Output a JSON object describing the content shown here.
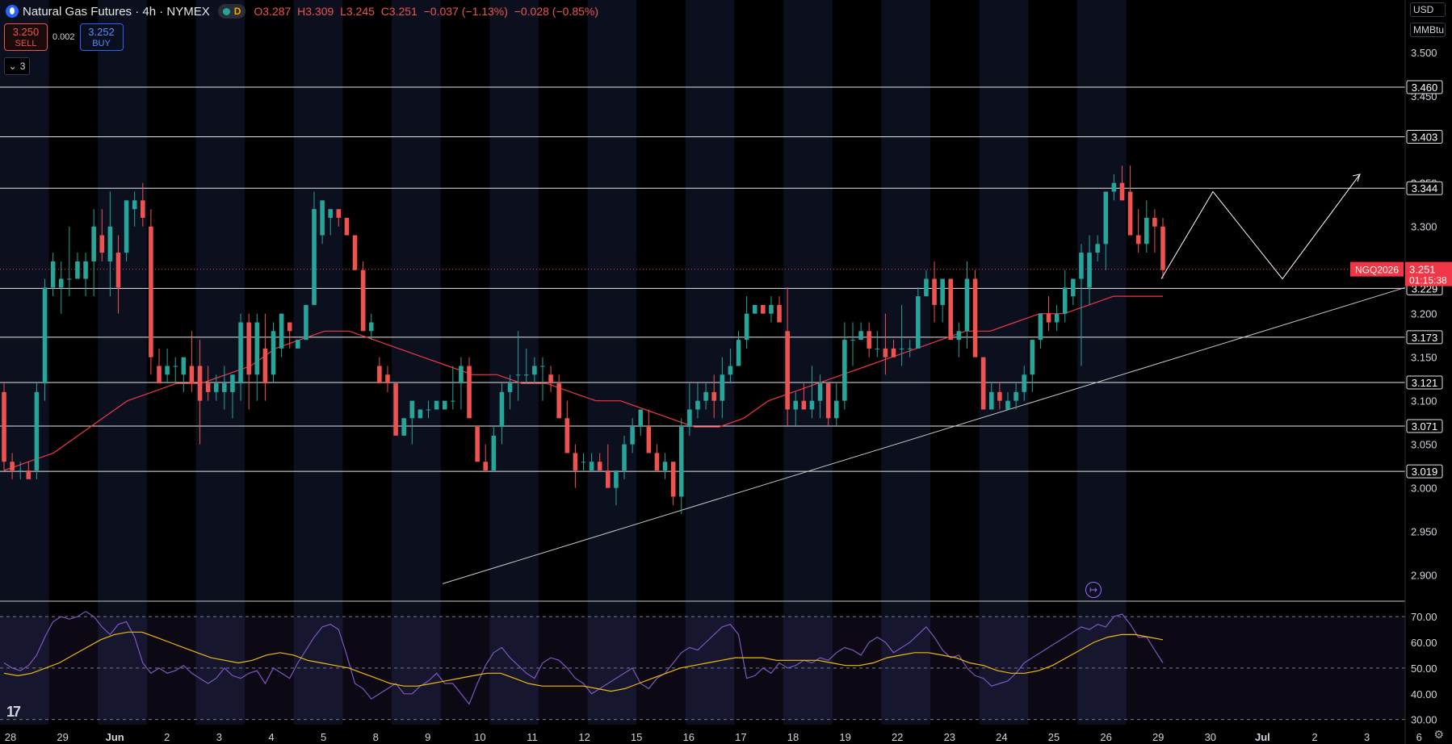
{
  "header": {
    "title": "Natural Gas Futures · 4h · NYMEX",
    "d_label": "D",
    "open": "O3.287",
    "high": "H3.309",
    "low": "L3.245",
    "close": "C3.251",
    "change": "−0.037 (−1.13%)",
    "change2": "−0.028 (−0.85%)",
    "dot_colors": [
      "#26a69a",
      "#2a2e39"
    ],
    "accent_color": "#2962ff"
  },
  "trade": {
    "sell_price": "3.250",
    "sell_label": "SELL",
    "spread": "0.002",
    "buy_price": "3.252",
    "buy_label": "BUY"
  },
  "indicators_collapse": {
    "count": "3"
  },
  "unit_selector": {
    "currency": "USD",
    "unit": "MMBtu"
  },
  "footer": {
    "logo": "17"
  },
  "chart_data": [
    {
      "type": "candlestick",
      "title": "Natural Gas Futures · 4h · NYMEX",
      "symbol": "NGQ2026",
      "ylim": [
        2.87,
        3.56
      ],
      "y_ticks": [
        "3.500",
        "3.450",
        "3.350",
        "3.300",
        "3.200",
        "3.150",
        "3.100",
        "3.050",
        "3.000",
        "2.950",
        "2.900"
      ],
      "x_tick_labels": [
        "28",
        "29",
        "Jun",
        "2",
        "3",
        "4",
        "5",
        "8",
        "9",
        "10",
        "11",
        "12",
        "15",
        "16",
        "17",
        "18",
        "19",
        "22",
        "23",
        "24",
        "25",
        "26",
        "29",
        "30",
        "Jul",
        "2",
        "3",
        "6"
      ],
      "horizontal_levels": [
        "3.460",
        "3.403",
        "3.344",
        "3.229",
        "3.173",
        "3.121",
        "3.071",
        "3.019"
      ],
      "last_price": {
        "value": "3.251",
        "countdown": "01:15:38",
        "label": "NGQ2026",
        "color": "#f23645"
      },
      "up_color": "#26a69a",
      "down_color": "#ef5350",
      "candles": [
        [
          3.11,
          3.12,
          3.02,
          3.03
        ],
        [
          3.03,
          3.04,
          3.01,
          3.02
        ],
        [
          3.02,
          3.03,
          3.01,
          3.02
        ],
        [
          3.02,
          3.03,
          3.01,
          3.01
        ],
        [
          3.02,
          3.12,
          3.01,
          3.11
        ],
        [
          3.12,
          3.24,
          3.1,
          3.23
        ],
        [
          3.23,
          3.27,
          3.22,
          3.26
        ],
        [
          3.23,
          3.26,
          3.2,
          3.24
        ],
        [
          3.24,
          3.3,
          3.22,
          3.24
        ],
        [
          3.24,
          3.27,
          3.24,
          3.26
        ],
        [
          3.24,
          3.27,
          3.22,
          3.26
        ],
        [
          3.26,
          3.32,
          3.22,
          3.3
        ],
        [
          3.29,
          3.32,
          3.26,
          3.27
        ],
        [
          3.26,
          3.34,
          3.22,
          3.3
        ],
        [
          3.27,
          3.29,
          3.2,
          3.23
        ],
        [
          3.27,
          3.33,
          3.26,
          3.33
        ],
        [
          3.32,
          3.34,
          3.3,
          3.33
        ],
        [
          3.33,
          3.35,
          3.3,
          3.31
        ],
        [
          3.3,
          3.32,
          3.13,
          3.15
        ],
        [
          3.14,
          3.16,
          3.12,
          3.12
        ],
        [
          3.13,
          3.16,
          3.12,
          3.14
        ],
        [
          3.14,
          3.15,
          3.12,
          3.14
        ],
        [
          3.13,
          3.15,
          3.11,
          3.15
        ],
        [
          3.14,
          3.18,
          3.11,
          3.12
        ],
        [
          3.14,
          3.17,
          3.05,
          3.1
        ],
        [
          3.12,
          3.14,
          3.1,
          3.11
        ],
        [
          3.11,
          3.13,
          3.1,
          3.12
        ],
        [
          3.11,
          3.14,
          3.09,
          3.12
        ],
        [
          3.11,
          3.13,
          3.08,
          3.13
        ],
        [
          3.12,
          3.2,
          3.1,
          3.19
        ],
        [
          3.19,
          3.2,
          3.09,
          3.13
        ],
        [
          3.13,
          3.2,
          3.1,
          3.19
        ],
        [
          3.16,
          3.2,
          3.1,
          3.12
        ],
        [
          3.13,
          3.19,
          3.12,
          3.18
        ],
        [
          3.16,
          3.2,
          3.15,
          3.2
        ],
        [
          3.19,
          3.19,
          3.16,
          3.18
        ],
        [
          3.16,
          3.17,
          3.16,
          3.17
        ],
        [
          3.17,
          3.21,
          3.17,
          3.21
        ],
        [
          3.21,
          3.34,
          3.21,
          3.32
        ],
        [
          3.29,
          3.33,
          3.28,
          3.33
        ],
        [
          3.31,
          3.32,
          3.29,
          3.32
        ],
        [
          3.32,
          3.31,
          3.3,
          3.31
        ],
        [
          3.31,
          3.31,
          3.3,
          3.29
        ],
        [
          3.29,
          3.29,
          3.25,
          3.25
        ],
        [
          3.25,
          3.26,
          3.18,
          3.18
        ],
        [
          3.18,
          3.2,
          3.17,
          3.19
        ],
        [
          3.14,
          3.15,
          3.13,
          3.12
        ],
        [
          3.13,
          3.14,
          3.11,
          3.12
        ],
        [
          3.12,
          3.12,
          3.1,
          3.06
        ],
        [
          3.06,
          3.08,
          3.06,
          3.08
        ],
        [
          3.08,
          3.08,
          3.05,
          3.1
        ],
        [
          3.08,
          3.09,
          3.08,
          3.09
        ],
        [
          3.09,
          3.1,
          3.08,
          3.09
        ],
        [
          3.09,
          3.1,
          3.1,
          3.1
        ],
        [
          3.09,
          3.1,
          3.1,
          3.1
        ],
        [
          3.1,
          3.14,
          3.09,
          3.1
        ],
        [
          3.12,
          3.15,
          3.09,
          3.14
        ],
        [
          3.14,
          3.15,
          3.1,
          3.08
        ],
        [
          3.07,
          3.07,
          3.06,
          3.03
        ],
        [
          3.03,
          3.05,
          3.02,
          3.02
        ],
        [
          3.02,
          3.07,
          3.02,
          3.06
        ],
        [
          3.07,
          3.12,
          3.05,
          3.11
        ],
        [
          3.11,
          3.13,
          3.09,
          3.12
        ],
        [
          3.13,
          3.18,
          3.1,
          3.13
        ],
        [
          3.13,
          3.16,
          3.12,
          3.13
        ],
        [
          3.13,
          3.15,
          3.12,
          3.14
        ],
        [
          3.14,
          3.15,
          3.1,
          3.14
        ],
        [
          3.13,
          3.14,
          3.11,
          3.12
        ],
        [
          3.12,
          3.13,
          3.09,
          3.08
        ],
        [
          3.08,
          3.1,
          3.05,
          3.04
        ],
        [
          3.04,
          3.05,
          3.0,
          3.02
        ],
        [
          3.03,
          3.04,
          3.02,
          3.03
        ],
        [
          3.02,
          3.04,
          3.02,
          3.03
        ],
        [
          3.03,
          3.04,
          3.02,
          3.02
        ],
        [
          3.02,
          3.05,
          3.0,
          3.0
        ],
        [
          3.0,
          3.01,
          2.98,
          3.02
        ],
        [
          3.02,
          3.06,
          3.01,
          3.05
        ],
        [
          3.05,
          3.08,
          3.04,
          3.07
        ],
        [
          3.07,
          3.09,
          3.06,
          3.09
        ],
        [
          3.07,
          3.09,
          3.05,
          3.04
        ],
        [
          3.04,
          3.05,
          3.02,
          3.02
        ],
        [
          3.02,
          3.04,
          3.01,
          3.03
        ],
        [
          3.03,
          3.03,
          2.98,
          2.99
        ],
        [
          2.99,
          3.08,
          2.97,
          3.07
        ],
        [
          3.07,
          3.12,
          3.06,
          3.09
        ],
        [
          3.09,
          3.12,
          3.08,
          3.1
        ],
        [
          3.1,
          3.12,
          3.09,
          3.11
        ],
        [
          3.11,
          3.13,
          3.08,
          3.1
        ],
        [
          3.1,
          3.15,
          3.08,
          3.13
        ],
        [
          3.13,
          3.16,
          3.12,
          3.14
        ],
        [
          3.14,
          3.18,
          3.14,
          3.17
        ],
        [
          3.17,
          3.22,
          3.16,
          3.2
        ],
        [
          3.2,
          3.21,
          3.2,
          3.21
        ],
        [
          3.21,
          3.21,
          3.2,
          3.2
        ],
        [
          3.2,
          3.22,
          3.19,
          3.21
        ],
        [
          3.21,
          3.22,
          3.19,
          3.19
        ],
        [
          3.18,
          3.23,
          3.07,
          3.09
        ],
        [
          3.09,
          3.11,
          3.07,
          3.1
        ],
        [
          3.1,
          3.12,
          3.09,
          3.09
        ],
        [
          3.09,
          3.14,
          3.08,
          3.1
        ],
        [
          3.1,
          3.13,
          3.08,
          3.12
        ],
        [
          3.12,
          3.12,
          3.07,
          3.08
        ],
        [
          3.08,
          3.12,
          3.07,
          3.1
        ],
        [
          3.1,
          3.19,
          3.09,
          3.17
        ],
        [
          3.17,
          3.19,
          3.14,
          3.17
        ],
        [
          3.17,
          3.19,
          3.17,
          3.18
        ],
        [
          3.18,
          3.19,
          3.15,
          3.16
        ],
        [
          3.16,
          3.18,
          3.15,
          3.16
        ],
        [
          3.16,
          3.2,
          3.13,
          3.15
        ],
        [
          3.16,
          3.17,
          3.15,
          3.15
        ],
        [
          3.16,
          3.21,
          3.14,
          3.16
        ],
        [
          3.16,
          3.17,
          3.15,
          3.16
        ],
        [
          3.16,
          3.23,
          3.16,
          3.22
        ],
        [
          3.22,
          3.25,
          3.22,
          3.24
        ],
        [
          3.24,
          3.26,
          3.19,
          3.21
        ],
        [
          3.21,
          3.24,
          3.19,
          3.24
        ],
        [
          3.24,
          3.23,
          3.2,
          3.17
        ],
        [
          3.17,
          3.19,
          3.15,
          3.18
        ],
        [
          3.18,
          3.26,
          3.16,
          3.24
        ],
        [
          3.24,
          3.25,
          3.17,
          3.15
        ],
        [
          3.15,
          3.15,
          3.13,
          3.09
        ],
        [
          3.09,
          3.12,
          3.09,
          3.11
        ],
        [
          3.11,
          3.12,
          3.09,
          3.1
        ],
        [
          3.09,
          3.11,
          3.09,
          3.1
        ],
        [
          3.1,
          3.12,
          3.09,
          3.11
        ],
        [
          3.11,
          3.14,
          3.1,
          3.13
        ],
        [
          3.13,
          3.16,
          3.11,
          3.17
        ],
        [
          3.17,
          3.19,
          3.16,
          3.2
        ],
        [
          3.2,
          3.22,
          3.18,
          3.19
        ],
        [
          3.19,
          3.21,
          3.18,
          3.2
        ],
        [
          3.2,
          3.25,
          3.19,
          3.23
        ],
        [
          3.22,
          3.24,
          3.21,
          3.24
        ],
        [
          3.24,
          3.28,
          3.14,
          3.27
        ],
        [
          3.23,
          3.29,
          3.21,
          3.27
        ],
        [
          3.27,
          3.29,
          3.26,
          3.28
        ],
        [
          3.28,
          3.32,
          3.25,
          3.34
        ],
        [
          3.34,
          3.36,
          3.33,
          3.35
        ],
        [
          3.35,
          3.37,
          3.33,
          3.33
        ],
        [
          3.34,
          3.37,
          3.3,
          3.29
        ],
        [
          3.29,
          3.32,
          3.27,
          3.28
        ],
        [
          3.28,
          3.33,
          3.27,
          3.31
        ],
        [
          3.31,
          3.32,
          3.27,
          3.3
        ],
        [
          3.3,
          3.31,
          3.24,
          3.25
        ]
      ],
      "ma_values": [
        3.02,
        3.03,
        3.04,
        3.06,
        3.08,
        3.1,
        3.11,
        3.12,
        3.12,
        3.13,
        3.14,
        3.16,
        3.17,
        3.18,
        3.18,
        3.17,
        3.16,
        3.15,
        3.14,
        3.13,
        3.13,
        3.12,
        3.12,
        3.11,
        3.1,
        3.1,
        3.09,
        3.08,
        3.07,
        3.07,
        3.08,
        3.1,
        3.11,
        3.12,
        3.13,
        3.14,
        3.15,
        3.16,
        3.17,
        3.18,
        3.18,
        3.19,
        3.2,
        3.2,
        3.21,
        3.22,
        3.22,
        3.22
      ],
      "trendline": {
        "start": [
          2.89,
          0.3
        ],
        "end": [
          3.23,
          1.0
        ]
      },
      "projection": [
        3.24,
        3.34,
        3.24,
        3.36
      ]
    },
    {
      "type": "line",
      "title": "RSI",
      "ylim": [
        28,
        76
      ],
      "y_ticks": [
        "70.00",
        "60.00",
        "50.00",
        "40.00",
        "30.00"
      ],
      "bands": [
        70,
        50,
        30
      ],
      "series": [
        {
          "name": "",
          "color": "#7e57c2",
          "values": [
            52,
            50,
            49,
            51,
            55,
            62,
            68,
            70,
            69,
            70,
            72,
            70,
            66,
            63,
            67,
            68,
            62,
            52,
            48,
            50,
            48,
            49,
            51,
            48,
            46,
            44,
            46,
            50,
            47,
            46,
            48,
            49,
            44,
            50,
            48,
            46,
            52,
            57,
            62,
            66,
            67,
            65,
            55,
            44,
            42,
            38,
            40,
            42,
            44,
            40,
            40,
            43,
            45,
            48,
            44,
            44,
            40,
            36,
            44,
            51,
            56,
            58,
            54,
            51,
            48,
            46,
            52,
            54,
            53,
            50,
            46,
            44,
            40,
            42,
            44,
            46,
            48,
            50,
            44,
            42,
            46,
            48,
            52,
            56,
            58,
            57,
            60,
            63,
            66,
            67,
            63,
            46,
            47,
            50,
            48,
            52,
            50,
            51,
            53,
            52,
            54,
            53,
            56,
            58,
            57,
            55,
            60,
            62,
            60,
            56,
            58,
            60,
            63,
            66,
            62,
            57,
            54,
            55,
            50,
            47,
            46,
            43,
            44,
            45,
            48,
            52,
            54,
            56,
            58,
            60,
            62,
            64,
            66,
            65,
            67,
            66,
            70,
            71,
            67,
            62,
            62,
            57,
            52
          ]
        },
        {
          "name": "",
          "color": "#f0b90b",
          "values": [
            48,
            47,
            48,
            50,
            52,
            55,
            58,
            61,
            63,
            64,
            64,
            62,
            60,
            58,
            56,
            54,
            53,
            52,
            53,
            55,
            56,
            55,
            53,
            52,
            51,
            50,
            48,
            46,
            44,
            43,
            43,
            44,
            45,
            46,
            47,
            48,
            48,
            46,
            44,
            43,
            43,
            43,
            43,
            42,
            41,
            42,
            44,
            46,
            48,
            50,
            51,
            52,
            53,
            54,
            54,
            54,
            53,
            53,
            53,
            53,
            52,
            51,
            51,
            52,
            54,
            55,
            56,
            56,
            55,
            54,
            52,
            51,
            49,
            48,
            48,
            49,
            51,
            54,
            57,
            60,
            62,
            63,
            63,
            62,
            61
          ]
        }
      ]
    }
  ]
}
